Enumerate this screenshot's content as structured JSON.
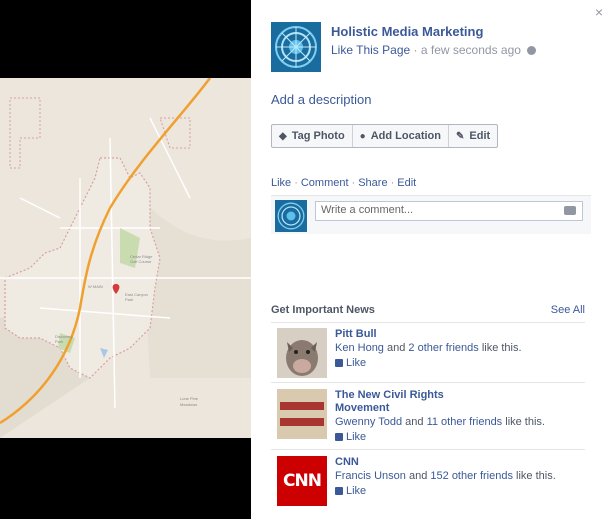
{
  "page": {
    "name": "Holistic Media Marketing",
    "like_label": "Like This Page",
    "separator": "·",
    "time": "a few seconds ago"
  },
  "close_label": "×",
  "add_description": "Add a description",
  "buttons": {
    "tag_photo": "Tag Photo",
    "add_location": "Add Location",
    "edit": "Edit"
  },
  "actions": {
    "like": "Like",
    "comment": "Comment",
    "share": "Share",
    "edit": "Edit",
    "separator": "·"
  },
  "comment": {
    "placeholder": "Write a comment..."
  },
  "news": {
    "heading": "Get Important News",
    "see_all": "See All",
    "items": [
      {
        "name": "Pitt Bull",
        "friend": "Ken Hong",
        "joiner": "and",
        "others": "2 other friends",
        "suffix": "like this.",
        "like_label": "Like"
      },
      {
        "name": "The New Civil Rights Movement",
        "friend": "Gwenny Todd",
        "joiner": "and",
        "others": "11 other friends",
        "suffix": "like this.",
        "like_label": "Like"
      },
      {
        "name": "CNN",
        "friend": "Francis Unson",
        "joiner": "and",
        "others": "152 other friends",
        "suffix": "like this.",
        "like_label": "Like",
        "logo_text": "CNN"
      }
    ]
  },
  "colors": {
    "link": "#3b5998",
    "map_bg": "#ece6dc",
    "highway": "#f0a030"
  }
}
